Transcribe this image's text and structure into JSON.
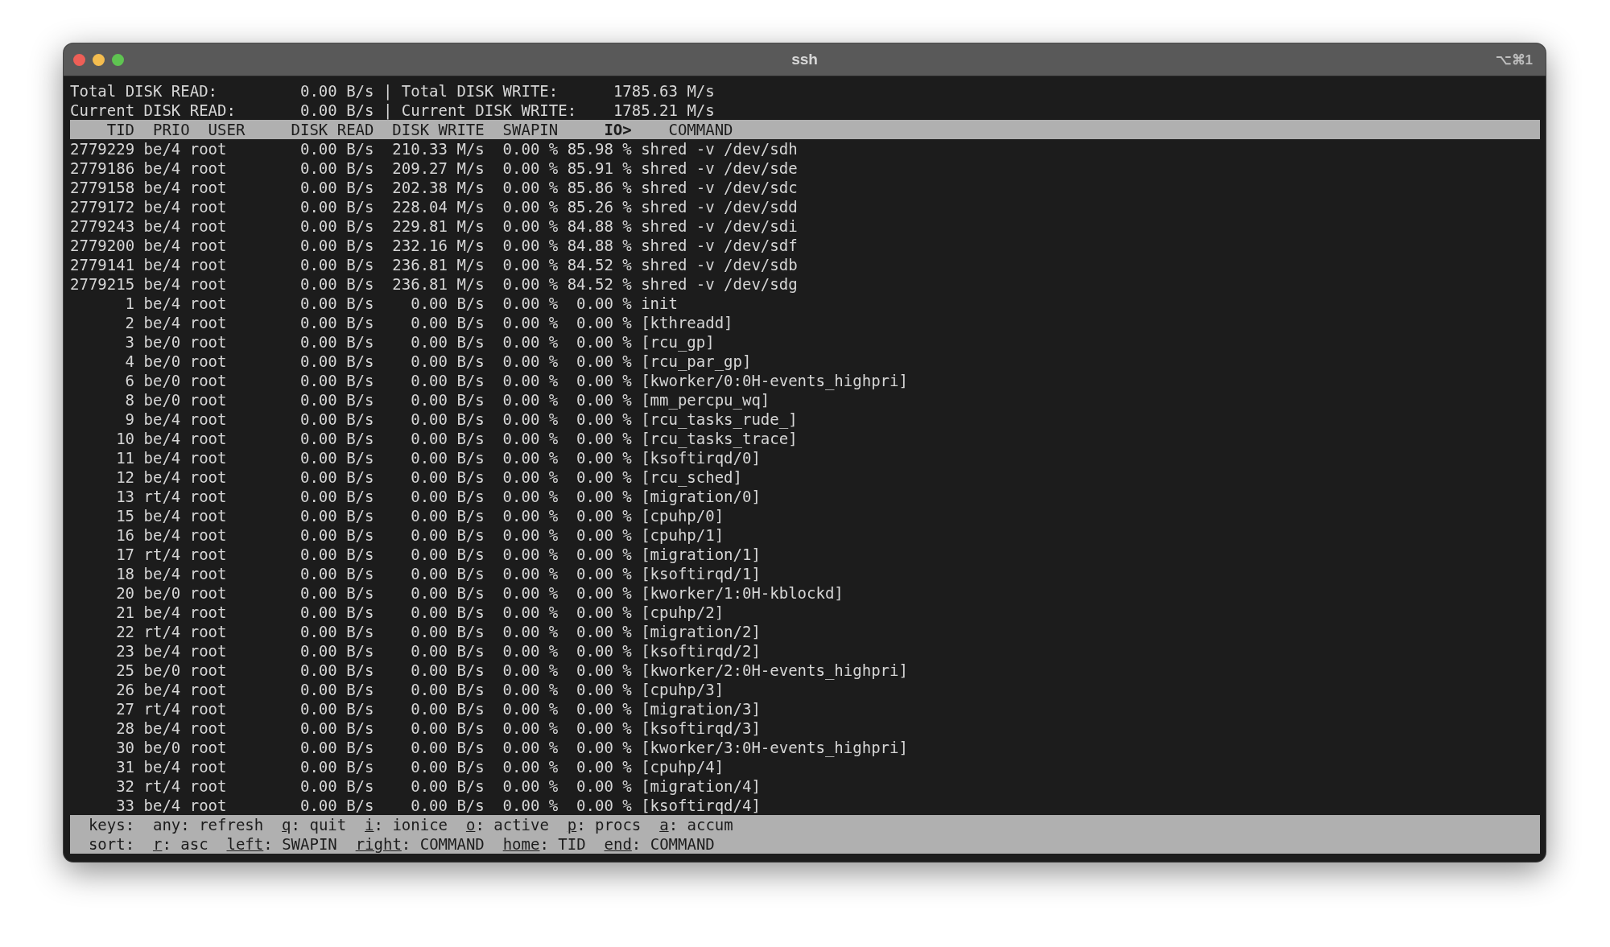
{
  "window": {
    "title": "ssh",
    "shortcut": "⌥⌘1"
  },
  "summary": [
    {
      "read_label": "Total DISK READ:",
      "read_value": "0.00 B/s",
      "separator": "|",
      "write_label": "Total DISK WRITE:",
      "write_value": "1785.63 M/s"
    },
    {
      "read_label": "Current DISK READ:",
      "read_value": "0.00 B/s",
      "separator": "|",
      "write_label": "Current DISK WRITE:",
      "write_value": "1785.21 M/s"
    }
  ],
  "table": {
    "columns": [
      {
        "label": "TID",
        "sorted": false
      },
      {
        "label": "PRIO",
        "sorted": false
      },
      {
        "label": "USER",
        "sorted": false
      },
      {
        "label": "DISK READ",
        "sorted": false
      },
      {
        "label": "DISK WRITE",
        "sorted": false
      },
      {
        "label": "SWAPIN",
        "sorted": false
      },
      {
        "label": "IO>",
        "sorted": true
      },
      {
        "label": "COMMAND",
        "sorted": false
      }
    ],
    "rows": [
      [
        "2779229",
        "be/4",
        "root",
        "0.00 B/s",
        "210.33 M/s",
        "0.00 %",
        "85.98 %",
        "shred -v /dev/sdh"
      ],
      [
        "2779186",
        "be/4",
        "root",
        "0.00 B/s",
        "209.27 M/s",
        "0.00 %",
        "85.91 %",
        "shred -v /dev/sde"
      ],
      [
        "2779158",
        "be/4",
        "root",
        "0.00 B/s",
        "202.38 M/s",
        "0.00 %",
        "85.86 %",
        "shred -v /dev/sdc"
      ],
      [
        "2779172",
        "be/4",
        "root",
        "0.00 B/s",
        "228.04 M/s",
        "0.00 %",
        "85.26 %",
        "shred -v /dev/sdd"
      ],
      [
        "2779243",
        "be/4",
        "root",
        "0.00 B/s",
        "229.81 M/s",
        "0.00 %",
        "84.88 %",
        "shred -v /dev/sdi"
      ],
      [
        "2779200",
        "be/4",
        "root",
        "0.00 B/s",
        "232.16 M/s",
        "0.00 %",
        "84.88 %",
        "shred -v /dev/sdf"
      ],
      [
        "2779141",
        "be/4",
        "root",
        "0.00 B/s",
        "236.81 M/s",
        "0.00 %",
        "84.52 %",
        "shred -v /dev/sdb"
      ],
      [
        "2779215",
        "be/4",
        "root",
        "0.00 B/s",
        "236.81 M/s",
        "0.00 %",
        "84.52 %",
        "shred -v /dev/sdg"
      ],
      [
        "1",
        "be/4",
        "root",
        "0.00 B/s",
        "0.00 B/s",
        "0.00 %",
        "0.00 %",
        "init"
      ],
      [
        "2",
        "be/4",
        "root",
        "0.00 B/s",
        "0.00 B/s",
        "0.00 %",
        "0.00 %",
        "[kthreadd]"
      ],
      [
        "3",
        "be/0",
        "root",
        "0.00 B/s",
        "0.00 B/s",
        "0.00 %",
        "0.00 %",
        "[rcu_gp]"
      ],
      [
        "4",
        "be/0",
        "root",
        "0.00 B/s",
        "0.00 B/s",
        "0.00 %",
        "0.00 %",
        "[rcu_par_gp]"
      ],
      [
        "6",
        "be/0",
        "root",
        "0.00 B/s",
        "0.00 B/s",
        "0.00 %",
        "0.00 %",
        "[kworker/0:0H-events_highpri]"
      ],
      [
        "8",
        "be/0",
        "root",
        "0.00 B/s",
        "0.00 B/s",
        "0.00 %",
        "0.00 %",
        "[mm_percpu_wq]"
      ],
      [
        "9",
        "be/4",
        "root",
        "0.00 B/s",
        "0.00 B/s",
        "0.00 %",
        "0.00 %",
        "[rcu_tasks_rude_]"
      ],
      [
        "10",
        "be/4",
        "root",
        "0.00 B/s",
        "0.00 B/s",
        "0.00 %",
        "0.00 %",
        "[rcu_tasks_trace]"
      ],
      [
        "11",
        "be/4",
        "root",
        "0.00 B/s",
        "0.00 B/s",
        "0.00 %",
        "0.00 %",
        "[ksoftirqd/0]"
      ],
      [
        "12",
        "be/4",
        "root",
        "0.00 B/s",
        "0.00 B/s",
        "0.00 %",
        "0.00 %",
        "[rcu_sched]"
      ],
      [
        "13",
        "rt/4",
        "root",
        "0.00 B/s",
        "0.00 B/s",
        "0.00 %",
        "0.00 %",
        "[migration/0]"
      ],
      [
        "15",
        "be/4",
        "root",
        "0.00 B/s",
        "0.00 B/s",
        "0.00 %",
        "0.00 %",
        "[cpuhp/0]"
      ],
      [
        "16",
        "be/4",
        "root",
        "0.00 B/s",
        "0.00 B/s",
        "0.00 %",
        "0.00 %",
        "[cpuhp/1]"
      ],
      [
        "17",
        "rt/4",
        "root",
        "0.00 B/s",
        "0.00 B/s",
        "0.00 %",
        "0.00 %",
        "[migration/1]"
      ],
      [
        "18",
        "be/4",
        "root",
        "0.00 B/s",
        "0.00 B/s",
        "0.00 %",
        "0.00 %",
        "[ksoftirqd/1]"
      ],
      [
        "20",
        "be/0",
        "root",
        "0.00 B/s",
        "0.00 B/s",
        "0.00 %",
        "0.00 %",
        "[kworker/1:0H-kblockd]"
      ],
      [
        "21",
        "be/4",
        "root",
        "0.00 B/s",
        "0.00 B/s",
        "0.00 %",
        "0.00 %",
        "[cpuhp/2]"
      ],
      [
        "22",
        "rt/4",
        "root",
        "0.00 B/s",
        "0.00 B/s",
        "0.00 %",
        "0.00 %",
        "[migration/2]"
      ],
      [
        "23",
        "be/4",
        "root",
        "0.00 B/s",
        "0.00 B/s",
        "0.00 %",
        "0.00 %",
        "[ksoftirqd/2]"
      ],
      [
        "25",
        "be/0",
        "root",
        "0.00 B/s",
        "0.00 B/s",
        "0.00 %",
        "0.00 %",
        "[kworker/2:0H-events_highpri]"
      ],
      [
        "26",
        "be/4",
        "root",
        "0.00 B/s",
        "0.00 B/s",
        "0.00 %",
        "0.00 %",
        "[cpuhp/3]"
      ],
      [
        "27",
        "rt/4",
        "root",
        "0.00 B/s",
        "0.00 B/s",
        "0.00 %",
        "0.00 %",
        "[migration/3]"
      ],
      [
        "28",
        "be/4",
        "root",
        "0.00 B/s",
        "0.00 B/s",
        "0.00 %",
        "0.00 %",
        "[ksoftirqd/3]"
      ],
      [
        "30",
        "be/0",
        "root",
        "0.00 B/s",
        "0.00 B/s",
        "0.00 %",
        "0.00 %",
        "[kworker/3:0H-events_highpri]"
      ],
      [
        "31",
        "be/4",
        "root",
        "0.00 B/s",
        "0.00 B/s",
        "0.00 %",
        "0.00 %",
        "[cpuhp/4]"
      ],
      [
        "32",
        "rt/4",
        "root",
        "0.00 B/s",
        "0.00 B/s",
        "0.00 %",
        "0.00 %",
        "[migration/4]"
      ],
      [
        "33",
        "be/4",
        "root",
        "0.00 B/s",
        "0.00 B/s",
        "0.00 %",
        "0.00 %",
        "[ksoftirqd/4]"
      ]
    ]
  },
  "footer": [
    {
      "label": "keys:",
      "hints": [
        {
          "key": "any",
          "underlined": false,
          "action": ": refresh"
        },
        {
          "key": "q",
          "underlined": true,
          "action": ": quit"
        },
        {
          "key": "i",
          "underlined": true,
          "action": ": ionice"
        },
        {
          "key": "o",
          "underlined": true,
          "action": ": active"
        },
        {
          "key": "p",
          "underlined": true,
          "action": ": procs"
        },
        {
          "key": "a",
          "underlined": true,
          "action": ": accum"
        }
      ]
    },
    {
      "label": "sort:",
      "hints": [
        {
          "key": "r",
          "underlined": true,
          "action": ": asc"
        },
        {
          "key": "left",
          "underlined": true,
          "action": ": SWAPIN"
        },
        {
          "key": "right",
          "underlined": true,
          "action": ": COMMAND"
        },
        {
          "key": "home",
          "underlined": true,
          "action": ": TID"
        },
        {
          "key": "end",
          "underlined": true,
          "action": ": COMMAND"
        }
      ]
    }
  ]
}
